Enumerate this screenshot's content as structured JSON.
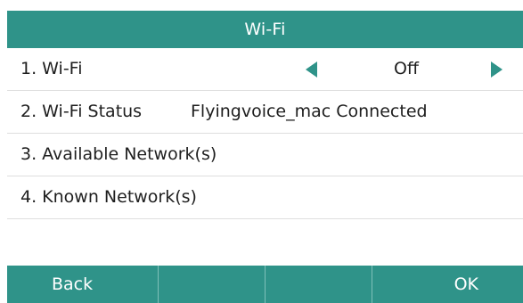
{
  "title": "Wi-Fi",
  "menu": {
    "items": [
      {
        "label": "1. Wi-Fi",
        "value": "Off"
      },
      {
        "label": "2. Wi-Fi Status",
        "value": "Flyingvoice_mac Connected"
      },
      {
        "label": "3. Available Network(s)"
      },
      {
        "label": "4. Known Network(s)"
      }
    ]
  },
  "softkeys": [
    "Back",
    "",
    "",
    "OK"
  ],
  "colors": {
    "accent": "#2f9389",
    "divider": "#dedede",
    "text": "#1e1e1e"
  },
  "icons": {
    "left_arrow": "triangle-left-icon",
    "right_arrow": "triangle-right-icon"
  }
}
